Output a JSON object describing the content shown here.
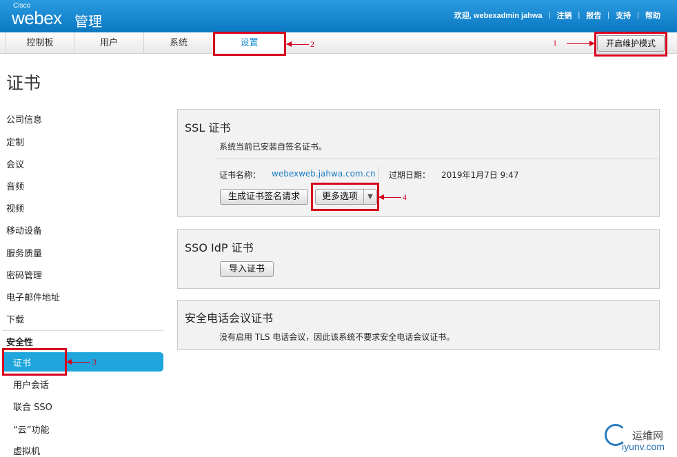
{
  "header": {
    "brand_small": "Cisco",
    "brand_main": "webex",
    "brand_sub": "管理",
    "welcome": "欢迎, webexadmin jahwa",
    "nav": [
      "注销",
      "报告",
      "支持",
      "帮助"
    ]
  },
  "tabs": [
    "控制板",
    "用户",
    "系统",
    "设置"
  ],
  "active_tab": "设置",
  "maintenance_button": "开启维护模式",
  "annotations": [
    "1",
    "2",
    "3",
    "4"
  ],
  "page_title": "证书",
  "sidebar": {
    "items": [
      "公司信息",
      "定制",
      "会议",
      "音频",
      "视频",
      "移动设备",
      "服务质量",
      "密码管理",
      "电子邮件地址",
      "下载"
    ],
    "section_header": "安全性",
    "sub_items": [
      "证书",
      "用户会话",
      "联合 SSO",
      "“云”功能",
      "虚拟机"
    ],
    "active_item": "证书"
  },
  "ssl": {
    "title": "SSL 证书",
    "description": "系统当前已安装自签名证书。",
    "name_label": "证书名称：",
    "name_value": "webexweb.jahwa.com.cn",
    "expiry_label": "过期日期：",
    "expiry_value": "2019年1月7日 9:47",
    "csr_button": "生成证书签名请求",
    "more_button": "更多选项",
    "more_arrow": "▼"
  },
  "sso": {
    "title": "SSO IdP 证书",
    "import_button": "导入证书"
  },
  "secure_call": {
    "title": "安全电话会议证书",
    "description": "没有启用 TLS 电话会议，因此该系统不要求安全电话会议证书。"
  },
  "watermark": {
    "line1": "运维网",
    "line2": "iyunv.com"
  },
  "colors": {
    "header_blue": "#0b78c2",
    "active_tab_text": "#1a8fd6",
    "sidebar_active": "#1ea6dd",
    "annotation_red": "#d6001c",
    "link_blue": "#1a7cc1"
  }
}
